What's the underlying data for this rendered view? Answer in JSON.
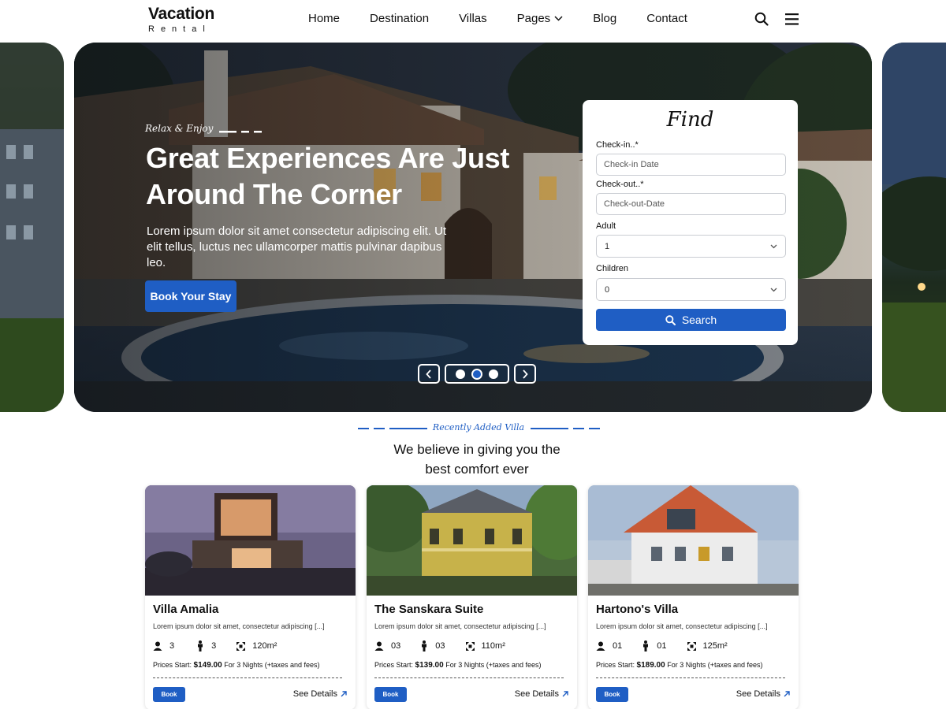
{
  "header": {
    "logo_title": "Vacation",
    "logo_sub": "Rental",
    "nav": [
      "Home",
      "Destination",
      "Villas",
      "Pages",
      "Blog",
      "Contact"
    ],
    "icons": [
      "search-icon",
      "menu-icon",
      "chevron-down-icon"
    ]
  },
  "hero": {
    "tagline": "Relax & Enjoy",
    "title": "Great Experiences Are Just Around The Corner",
    "description": "Lorem ipsum dolor sit amet consectetur adipiscing elit. Ut elit tellus, luctus nec ullamcorper mattis pulvinar dapibus leo.",
    "button": "Book Your Stay",
    "slides": 3,
    "active_slide": 2
  },
  "find": {
    "title": "Find",
    "checkin_label": "Check-in..*",
    "checkin_placeholder": "Check-in Date",
    "checkout_label": "Check-out..*",
    "checkout_placeholder": "Check-out-Date",
    "adult_label": "Adult",
    "adult_value": "1",
    "children_label": "Children",
    "children_value": "0",
    "search_button": "Search"
  },
  "section": {
    "kicker": "Recently Added Villa",
    "title_line1": "We believe in giving you the",
    "title_line2": "best comfort ever"
  },
  "cards": [
    {
      "name": "Villa Amalia",
      "desc": "Lorem ipsum dolor sit amet, consectetur adipiscing [...]",
      "guests": "3",
      "rooms": "3",
      "area": "120m²",
      "price_label": "Prices Start:",
      "price": "$149.00",
      "price_note": "For 3 Nights (+taxes and fees)",
      "book": "Book",
      "details": "See Details"
    },
    {
      "name": "The Sanskara Suite",
      "desc": "Lorem ipsum dolor sit amet, consectetur adipiscing [...]",
      "guests": "03",
      "rooms": "03",
      "area": "110m²",
      "price_label": "Prices Start:",
      "price": "$139.00",
      "price_note": "For 3 Nights (+taxes and fees)",
      "book": "Book",
      "details": "See Details"
    },
    {
      "name": "Hartono's Villa",
      "desc": "Lorem ipsum dolor sit amet, consectetur adipiscing [...]",
      "guests": "01",
      "rooms": "01",
      "area": "125m²",
      "price_label": "Prices Start:",
      "price": "$189.00",
      "price_note": "For 3 Nights (+taxes and fees)",
      "book": "Book",
      "details": "See Details"
    }
  ],
  "colors": {
    "accent": "#1f5ec4",
    "text": "#111111",
    "background": "#ffffff"
  }
}
